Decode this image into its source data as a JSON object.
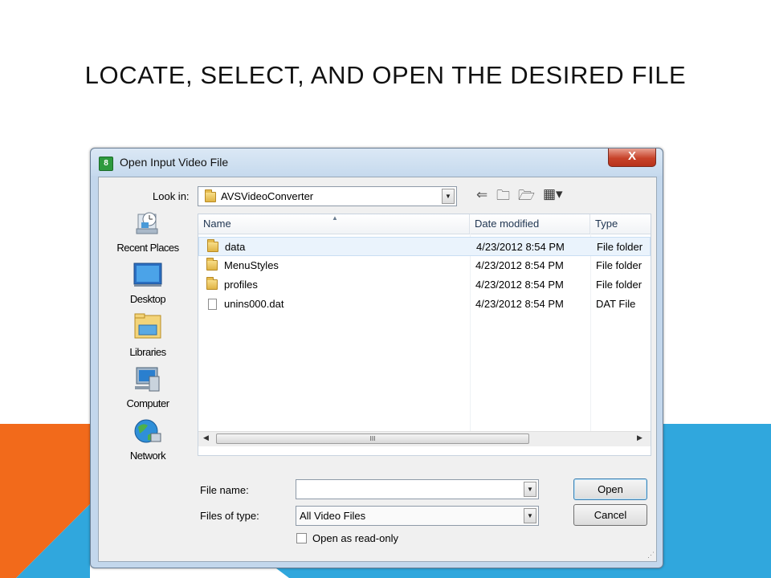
{
  "slide": {
    "title": "LOCATE, SELECT, AND OPEN THE DESIRED FILE",
    "colors": {
      "orange": "#f26a1b",
      "blue": "#30a7dd"
    }
  },
  "dialog": {
    "title": "Open Input Video File",
    "app_icon": "8",
    "close_label": "X",
    "look_in_label": "Look in:",
    "look_in_value": "AVSVideoConverter",
    "toolbar": [
      "back-arrow-icon",
      "up-folder-icon",
      "new-folder-icon",
      "views-menu-icon"
    ],
    "places": [
      {
        "label": "Recent Places",
        "icon": "recent-places-icon"
      },
      {
        "label": "Desktop",
        "icon": "desktop-icon"
      },
      {
        "label": "Libraries",
        "icon": "libraries-icon"
      },
      {
        "label": "Computer",
        "icon": "computer-icon"
      },
      {
        "label": "Network",
        "icon": "network-icon"
      }
    ],
    "columns": {
      "name": "Name",
      "date": "Date modified",
      "type": "Type"
    },
    "files": [
      {
        "name": "data",
        "date": "4/23/2012 8:54 PM",
        "type": "File folder",
        "icon": "folder-icon"
      },
      {
        "name": "MenuStyles",
        "date": "4/23/2012 8:54 PM",
        "type": "File folder",
        "icon": "folder-icon"
      },
      {
        "name": "profiles",
        "date": "4/23/2012 8:54 PM",
        "type": "File folder",
        "icon": "folder-icon"
      },
      {
        "name": "unins000.dat",
        "date": "4/23/2012 8:54 PM",
        "type": "DAT File",
        "icon": "file-icon"
      }
    ],
    "scroll_thumb": "III",
    "file_name_label": "File name:",
    "file_name_value": "",
    "files_of_type_label": "Files of type:",
    "files_of_type_value": "All Video Files",
    "open_button": "Open",
    "cancel_button": "Cancel",
    "read_only_label": "Open as read-only",
    "read_only_checked": false
  }
}
